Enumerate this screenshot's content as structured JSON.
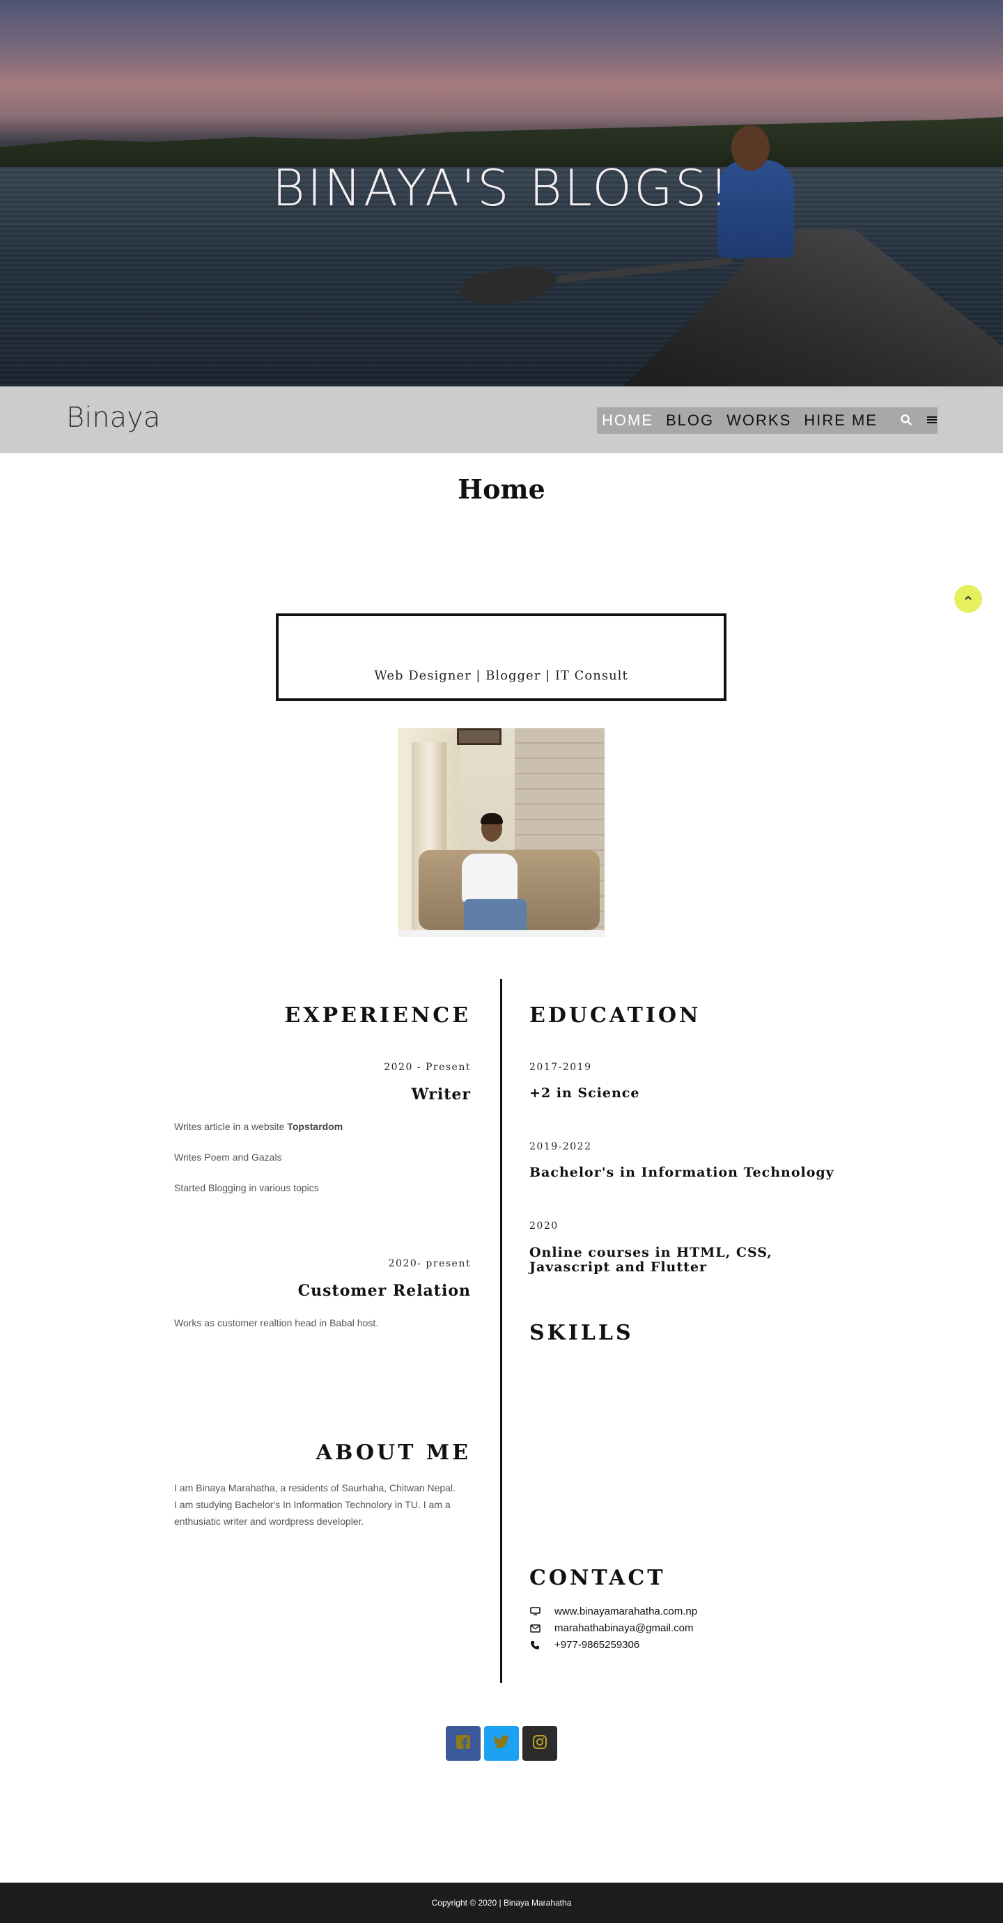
{
  "hero": {
    "title": "BINAYA'S BLOGS!"
  },
  "navbar": {
    "brand": "Binaya",
    "items": [
      {
        "label": "HOME",
        "active": true
      },
      {
        "label": "BLOG",
        "active": false
      },
      {
        "label": "WORKS",
        "active": false
      },
      {
        "label": "HIRE ME",
        "active": false
      }
    ],
    "search_icon": "search-icon",
    "menu_icon": "hamburger-menu-icon"
  },
  "page": {
    "title": "Home",
    "tagline": "Web Designer | Blogger | IT Consult",
    "scroll_top_icon": "chevron-up-icon"
  },
  "experience": {
    "heading": "EXPERIENCE",
    "items": [
      {
        "period": "2020 - Present",
        "role": "Writer",
        "details": [
          {
            "text": "Writes article in a website ",
            "bold": "Topstardom"
          },
          {
            "text": "Writes Poem and Gazals",
            "bold": ""
          },
          {
            "text": "Started Blogging in various topics",
            "bold": ""
          }
        ]
      },
      {
        "period": "2020- present",
        "role": "Customer Relation",
        "details": [
          {
            "text": "Works as customer realtion head in Babal host.",
            "bold": ""
          }
        ]
      }
    ]
  },
  "about": {
    "heading": "ABOUT ME",
    "text": "I am Binaya Marahatha, a residents of Saurhaha, Chitwan Nepal. I am studying Bachelor's In Information Technolory in TU. I am a enthusiatic writer and wordpress developler."
  },
  "education": {
    "heading": "EDUCATION",
    "items": [
      {
        "period": "2017-2019",
        "title_lines": [
          "+2 in Science"
        ]
      },
      {
        "period": "2019-2022",
        "title_lines": [
          "Bachelor's in Information Technology"
        ]
      },
      {
        "period": "2020",
        "title_lines": [
          "Online courses in HTML, CSS,",
          "Javascript and Flutter"
        ]
      }
    ]
  },
  "skills": {
    "heading": "SKILLS"
  },
  "contact": {
    "heading": "CONTACT",
    "items": [
      {
        "icon": "monitor-icon",
        "text": "www.binayamarahatha.com.np"
      },
      {
        "icon": "envelope-icon",
        "text": "marahathabinaya@gmail.com"
      },
      {
        "icon": "phone-icon",
        "text": "+977-9865259306"
      }
    ]
  },
  "social": [
    {
      "icon": "facebook-icon",
      "color": "#3b5998",
      "glyph": "#8a7a1a"
    },
    {
      "icon": "twitter-icon",
      "color": "#1da1f2",
      "glyph": "#8a7a1a"
    },
    {
      "icon": "instagram-icon",
      "color": "#2b2b2b",
      "glyph": "#b8a22a"
    }
  ],
  "footer": {
    "copyright": "Copyright © 2020 | Binaya Marahatha"
  },
  "colors": {
    "navbar_bg": "#cccccc",
    "menu_bg": "#a8a8a8",
    "accent_yellow": "#e6ef5e",
    "footer_bg": "#1c1c1c"
  }
}
